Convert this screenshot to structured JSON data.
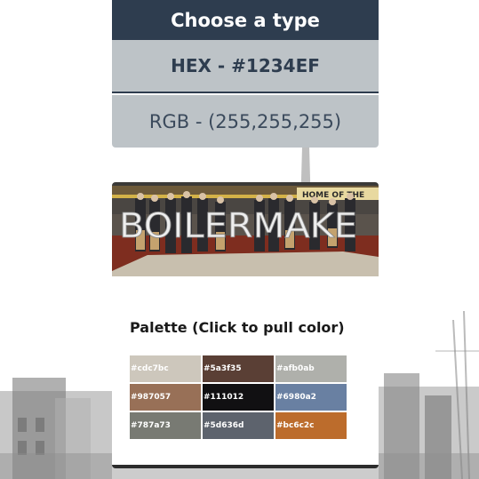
{
  "header": {
    "title": "Choose a type"
  },
  "type_options": [
    {
      "label": "HEX - #1234EF",
      "selected": true
    },
    {
      "label": "RGB - (255,255,255)",
      "selected": false
    }
  ],
  "photo": {
    "sign_text": "HOME OF THE",
    "letters": "BOILERMAKE"
  },
  "palette": {
    "title": "Palette (Click to pull color)",
    "swatches": [
      {
        "label": "#cdc7bc",
        "color": "#cdc7bc"
      },
      {
        "label": "#5a3f35",
        "color": "#5a3f35"
      },
      {
        "label": "#afb0ab",
        "color": "#afb0ab"
      },
      {
        "label": "#987057",
        "color": "#987057"
      },
      {
        "label": "#111012",
        "color": "#111012"
      },
      {
        "label": "#6980a2",
        "color": "#6980a2"
      },
      {
        "label": "#787a73",
        "color": "#787a73"
      },
      {
        "label": "#5d636d",
        "color": "#5d636d"
      },
      {
        "label": "#bc6c2c",
        "color": "#bc6c2c"
      }
    ]
  },
  "colors": {
    "header_bg": "#2e3d4f",
    "button_bg": "#bdc3c7",
    "button_text": "#2e3d4f"
  }
}
